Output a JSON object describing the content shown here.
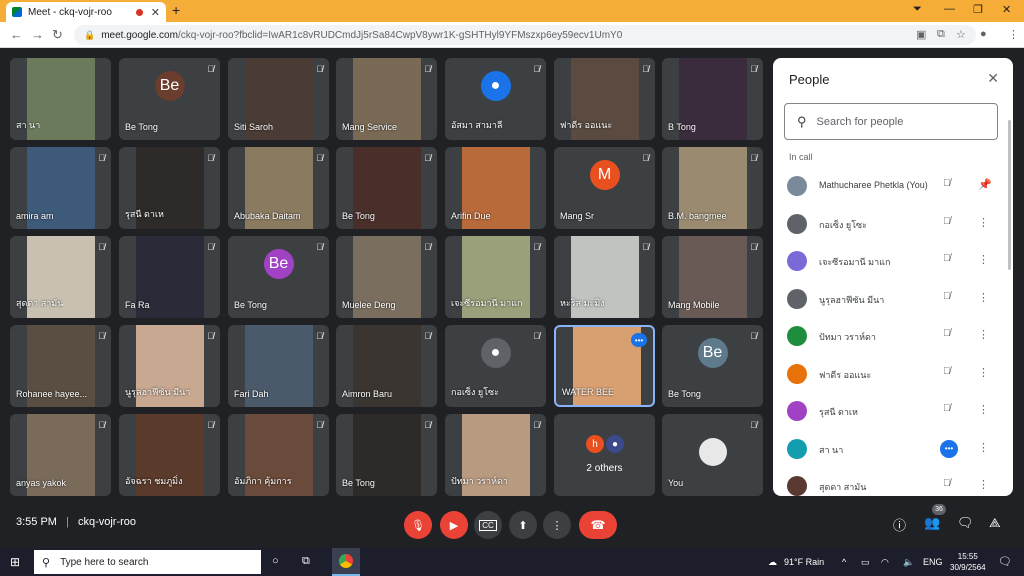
{
  "browser": {
    "tab_title": "Meet - ckq-vojr-roo",
    "new_tab": "+",
    "url_domain": "meet.google.com",
    "url_path": "/ckq-vojr-roo?fbclid=IwAR1c8vRUDCmdJj5rSa84CwpV8ywr1K-gSHTHyl9YFMszxp6ey59ecv1UmY0"
  },
  "tiles": [
    {
      "name": "สา นา",
      "type": "video",
      "color": "#6b7a5a"
    },
    {
      "name": "Be Tong",
      "type": "avatar",
      "initial": "Be",
      "color": "#6a3d2e"
    },
    {
      "name": "Siti Saroh",
      "type": "video",
      "color": "#4a3b35"
    },
    {
      "name": "Mang Service",
      "type": "video",
      "color": "#7a6a55"
    },
    {
      "name": "อัสมา สามาลี",
      "type": "avatar",
      "initial": "",
      "color": "#1a73e8"
    },
    {
      "name": "ฟาดีร ออแนะ",
      "type": "video",
      "color": "#5a4a40"
    },
    {
      "name": "B Tong",
      "type": "video",
      "color": "#3a2c3c"
    },
    {
      "name": "amira am",
      "type": "video",
      "color": "#3e5a7a"
    },
    {
      "name": "รุสนี ดาเห",
      "type": "video",
      "color": "#2e2a2a"
    },
    {
      "name": "Abubaka Daitam",
      "type": "video",
      "color": "#8a7a60"
    },
    {
      "name": "Be Tong",
      "type": "video",
      "color": "#4a2e2a"
    },
    {
      "name": "Arifin Due",
      "type": "video",
      "color": "#b86a3a"
    },
    {
      "name": "Mang Sr",
      "type": "avatar",
      "initial": "M",
      "color": "#e8501f"
    },
    {
      "name": "B.M. bangmee",
      "type": "video",
      "color": "#9a8a70"
    },
    {
      "name": "สุดดา สามัน",
      "type": "video",
      "color": "#c8c0b0"
    },
    {
      "name": "Fa Ra",
      "type": "video",
      "color": "#2a2a38"
    },
    {
      "name": "Be Tong",
      "type": "avatar",
      "initial": "Be",
      "color": "#a142c4"
    },
    {
      "name": "Muelee Deng",
      "type": "video",
      "color": "#7a6e5e"
    },
    {
      "name": "เจะซีรอมานี มาแก",
      "type": "video",
      "color": "#9aa07a"
    },
    {
      "name": "หะริส มะมิง",
      "type": "video",
      "color": "#c0c4c0"
    },
    {
      "name": "Mang Mobile",
      "type": "video",
      "color": "#6a5a55"
    },
    {
      "name": "Rohanee hayee...",
      "type": "video",
      "color": "#5a4e42"
    },
    {
      "name": "นูรุลฮาฟีซัน มีนา",
      "type": "video",
      "color": "#c8a890"
    },
    {
      "name": "Fari Dah",
      "type": "video",
      "color": "#4a5a6a"
    },
    {
      "name": "Aimron Baru",
      "type": "video",
      "color": "#3a3530"
    },
    {
      "name": "กอเซ็ง ยูโซะ",
      "type": "avatar",
      "initial": "",
      "color": "#5f6368"
    },
    {
      "name": "WATER BEE",
      "type": "video",
      "color": "#d8a070",
      "active": true
    },
    {
      "name": "Be Tong",
      "type": "avatar",
      "initial": "Be",
      "color": "#5f7a8a"
    },
    {
      "name": "anyas yakok",
      "type": "video",
      "color": "#7a6a5a"
    },
    {
      "name": "อัจฉรา ชมภูมิ่ง",
      "type": "video",
      "color": "#5a3a2a"
    },
    {
      "name": "อัมภิกา คุ้มการ",
      "type": "video",
      "color": "#6a4a3a"
    },
    {
      "name": "Be Tong",
      "type": "video",
      "color": "#2e2a28"
    },
    {
      "name": "ปัทมา วราห์ดา",
      "type": "video",
      "color": "#b89a80"
    },
    {
      "name": "2 others",
      "type": "others",
      "small_initial": "h"
    },
    {
      "name": "You",
      "type": "you",
      "color": "#e8e8e8"
    }
  ],
  "people_panel": {
    "title": "People",
    "search_placeholder": "Search for people",
    "section": "In call",
    "people": [
      {
        "name": "Mathucharee Phetkla (You)",
        "color": "#7a8a9a",
        "action": "pin"
      },
      {
        "name": "กอเซ็ง ยูโซะ",
        "color": "#5f6368",
        "action": "more"
      },
      {
        "name": "เจะซีรอมานี มาแก",
        "color": "#7a6ad8",
        "action": "more"
      },
      {
        "name": "นูรุลฮาฟีซัน มีนา",
        "color": "#5f6368",
        "action": "more"
      },
      {
        "name": "ปัทมา วราห์ดา",
        "color": "#1e8e3e",
        "action": "more"
      },
      {
        "name": "ฟาดีร ออแนะ",
        "color": "#e8710a",
        "action": "more"
      },
      {
        "name": "รุสนี ดาเห",
        "color": "#a142c4",
        "action": "more"
      },
      {
        "name": "สา นา",
        "color": "#129eaf",
        "action": "speaking"
      },
      {
        "name": "สุดดา สามัน",
        "color": "#5a3a30",
        "action": "more"
      }
    ]
  },
  "bottom_bar": {
    "time": "3:55 PM",
    "meeting_code": "ckq-vojr-roo",
    "participant_count": "36"
  },
  "taskbar": {
    "search_text": "Type here to search",
    "weather": "91°F  Rain",
    "language": "ENG",
    "time": "15:55",
    "date": "30/9/2564"
  }
}
